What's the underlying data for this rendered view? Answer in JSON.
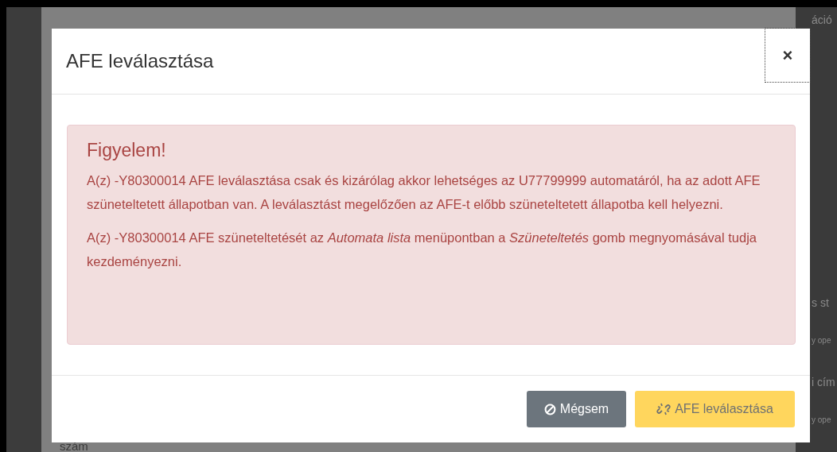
{
  "background_fragments": [
    {
      "text": "áció",
      "kind": "label"
    },
    {
      "text": "s st",
      "kind": "label"
    },
    {
      "text": "y ope",
      "kind": "hint"
    },
    {
      "text": "i cím",
      "kind": "label"
    },
    {
      "text": "y ope",
      "kind": "hint"
    }
  ],
  "background_left_text": "szám",
  "modal": {
    "title": "AFE leválasztása",
    "close": {
      "label": "×",
      "focused": true
    },
    "alert": {
      "heading": "Figyelem!",
      "paragraphs": [
        "A(z) -Y80300014 AFE leválasztása csak és kizárólag akkor lehetséges az U77799999 automatáról, ha az adott AFE szüneteltetett állapotban van. A leválasztást megelőzően az AFE-t előbb szüneteltetett állapotba kell helyezni.",
        "A(z) -Y80300014 AFE szüneteltetését az *Automata lista* menüpontban a *Szüneteltetés* gomb megnyomásával tudja kezdeményezni."
      ]
    },
    "buttons": [
      {
        "kind": "cancel",
        "label": "Mégsem",
        "disabled": false
      },
      {
        "kind": "detach",
        "label": "AFE leválasztása",
        "disabled": true
      }
    ]
  }
}
